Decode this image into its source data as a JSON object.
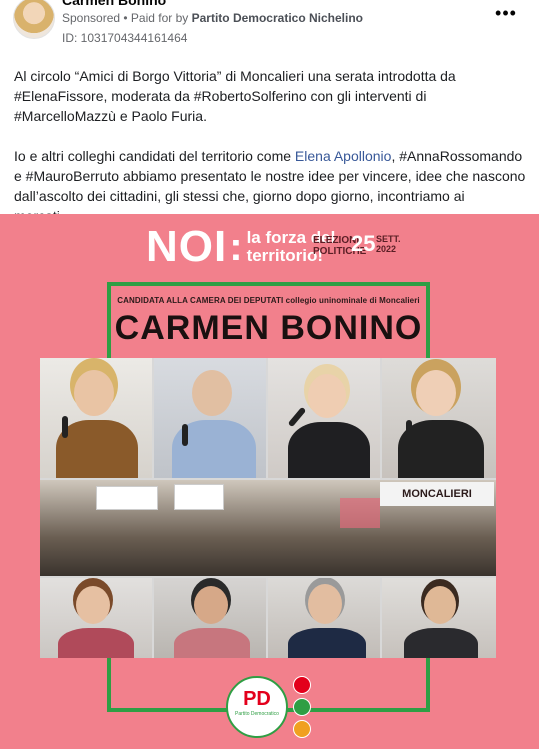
{
  "post": {
    "author": "Carmen Bonino",
    "sponsored_label": "Sponsored",
    "separator": " • ",
    "paid_for_prefix": "Paid for by ",
    "paid_for_by": "Partito Democratico Nichelino",
    "ad_id": "ID: 1031704344161464",
    "more_label": "•••",
    "body": {
      "p1": "Al circolo “Amici di Borgo Vittoria” di Moncalieri una serata introdotta da #ElenaFissore, moderata da #RobertoSolferino con gli interventi di #MarcelloMazzù e Paolo Furia.",
      "p2_before": "Io e altri colleghi candidati del territorio come ",
      "p2_link": "Elena Apollonio",
      "p2_after": ", #AnnaRossomando e #MauroBerruto abbiamo presentato le nostre idee per vincere, idee che nascono dall’ascolto dei cittadini, gli stessi che, giorno dopo giorno, incontriamo ai mercati…"
    }
  },
  "creative": {
    "noi": "NOI",
    "colon": ":",
    "tagline": "la forza del territorio!",
    "elezioni": "ELEZIONI",
    "politiche": "POLITICHE",
    "date_day": "25",
    "date_month": "SETT.",
    "date_year": "2022",
    "subtitle": "CANDIDATA ALLA CAMERA DEI DEPUTATI collegio uninominale di Moncalieri",
    "candidate_name": "CARMEN BONINO",
    "banner_text": "MONCALIERI",
    "logo_text": "PD",
    "logo_sub": "Partito Democratico"
  },
  "colors": {
    "background_pink": "#f2808c",
    "frame_green": "#2f9e44",
    "pd_red": "#e3001b",
    "link_blue": "#385898"
  }
}
